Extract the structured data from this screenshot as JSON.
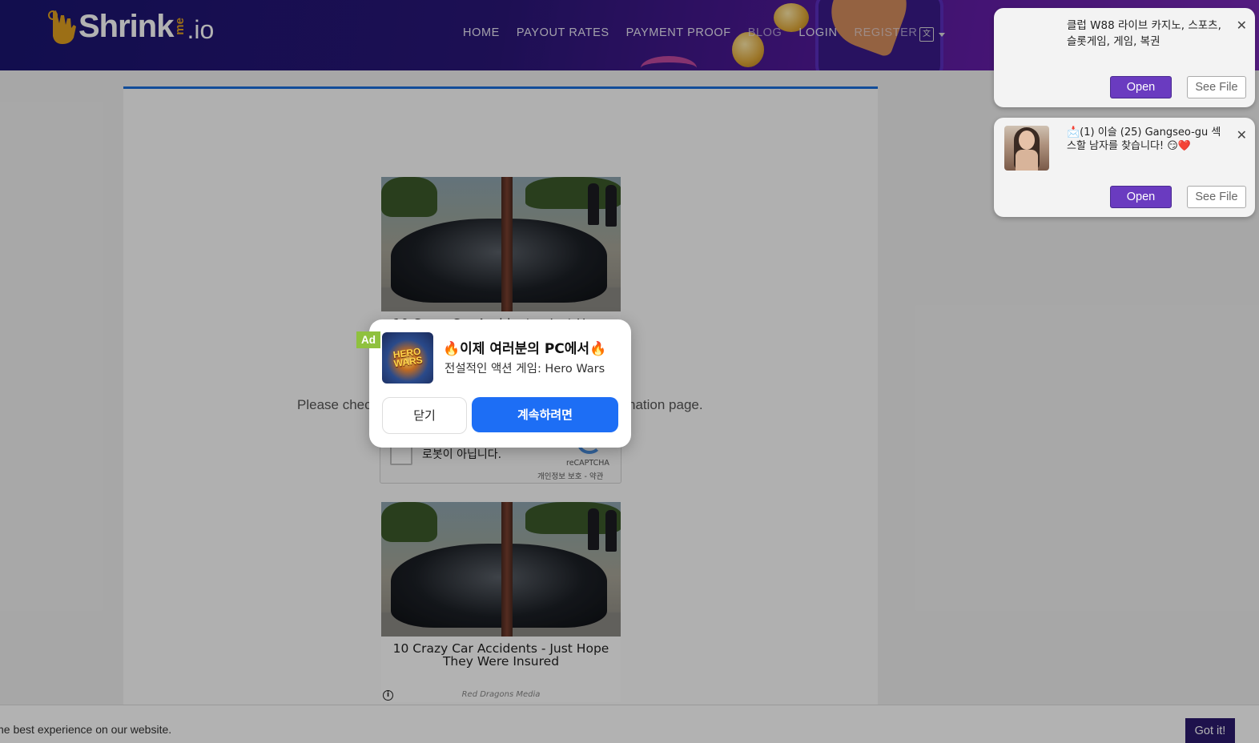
{
  "header": {
    "logo": {
      "text": "Shrink",
      "me": "me",
      "io": ".io"
    },
    "nav": [
      "HOME",
      "PAYOUT RATES",
      "PAYMENT PROOF",
      "BLOG",
      "LOGIN",
      "REGISTER"
    ]
  },
  "content": {
    "ad_top": {
      "title": "10 Crazy Car Accidents - Just Hope"
    },
    "check_text_left": "Please chec",
    "check_text_right": "nation page.",
    "recaptcha": {
      "label": "로봇이 아닙니다.",
      "brand": "reCAPTCHA",
      "links": "개인정보 보호 - 약관"
    },
    "ad_bottom": {
      "title": "10 Crazy Car Accidents - Just Hope They Were Insured",
      "source": "Red Dragons Media"
    }
  },
  "modal": {
    "badge": "Ad",
    "icon_text": "HERO WARS",
    "title": "🔥이제 여러분의 PC에서🔥",
    "subtitle": "전설적인 액션 게임: Hero Wars",
    "close_label": "닫기",
    "continue_label": "계속하려면",
    "continue_color": "#1d6ef5"
  },
  "notifications": [
    {
      "text": "클럽 W88 라이브 카지노, 스포츠, 슬롯게임, 게임, 복권",
      "open_label": "Open",
      "see_label": "See File"
    },
    {
      "text": "📩(1) 이슬 (25) Gangseo-gu 섹스할 남자를 찾습니다! 😏❤️",
      "open_label": "Open",
      "see_label": "See File"
    }
  ],
  "cookie": {
    "text": "he best experience on our website.",
    "button_label": "Got it!"
  },
  "colors": {
    "header_bg": "#2a1678",
    "accent_blue": "#1a6fdc",
    "open_purple": "#6a3bc0",
    "ad_green": "#8fc13e"
  }
}
